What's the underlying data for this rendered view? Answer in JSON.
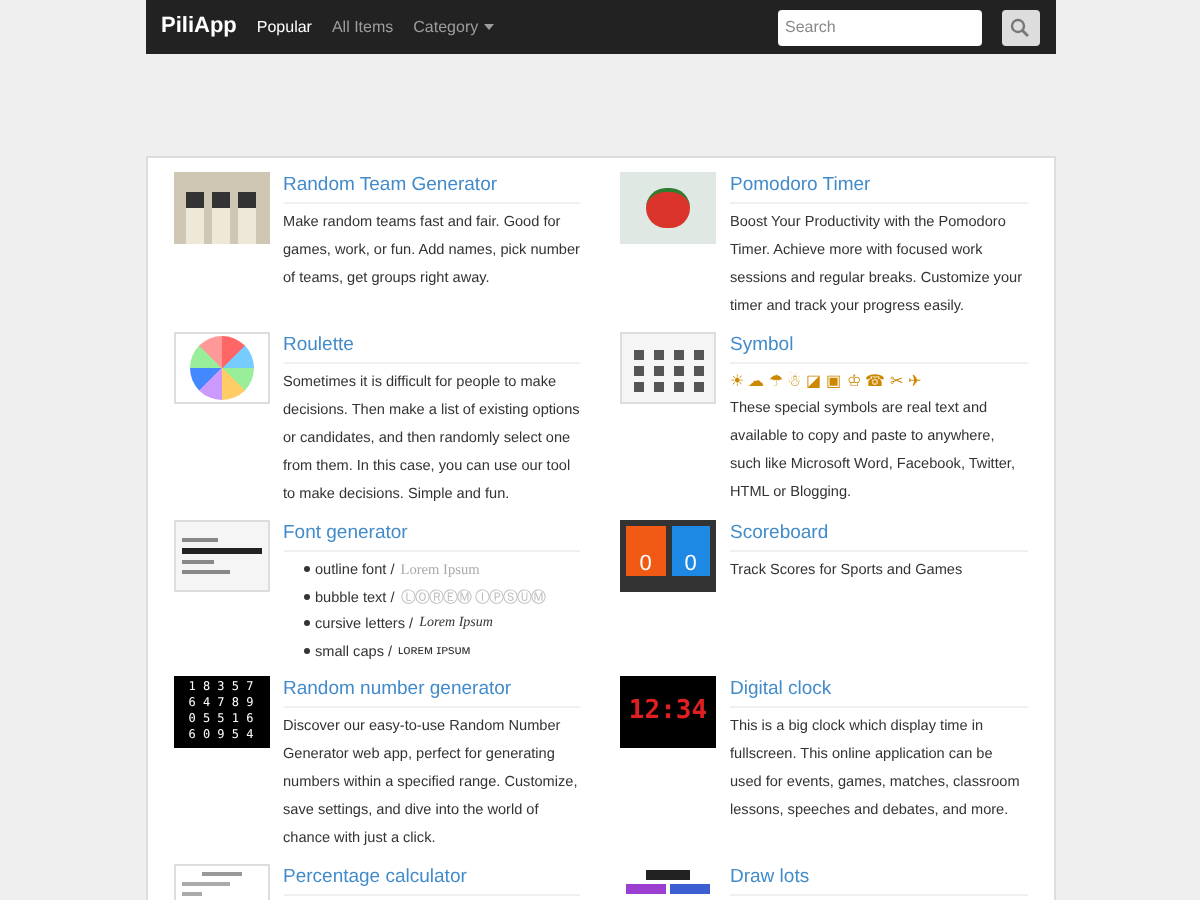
{
  "navbar": {
    "brand": "PiliApp",
    "links": [
      {
        "label": "Popular",
        "selected": true
      },
      {
        "label": "All Items",
        "selected": false
      },
      {
        "label": "Category",
        "selected": false,
        "dropdown": true
      }
    ],
    "search": {
      "placeholder": "Search"
    }
  },
  "items": [
    {
      "title": "Random Team Generator",
      "thumb": {
        "kind": "team"
      },
      "description": "Make random teams fast and fair. Good for games, work, or fun. Add names, pick number of teams, get groups right away."
    },
    {
      "title": "Pomodoro Timer",
      "thumb": {
        "kind": "tomato"
      },
      "description": "Boost Your Productivity with the Pomodoro Timer. Achieve more with focused work sessions and regular breaks. Customize your timer and track your progress easily."
    },
    {
      "title": "Roulette",
      "thumb": {
        "kind": "wheel"
      },
      "description": "Sometimes it is difficult for people to make decisions. Then make a list of existing options or candidates, and then randomly select one from them. In this case, you can use our tool to make decisions. Simple and fun."
    },
    {
      "title": "Symbol",
      "thumb": {
        "kind": "symbols"
      },
      "symbols": "☀ ☁ ☂ ☃ ◪ ▣ ♔ ☎ ✂ ✈",
      "description": "These special symbols are real text and available to copy and paste to anywhere, such like Microsoft Word, Facebook, Twitter, HTML or Blogging."
    },
    {
      "title": "Font generator",
      "thumb": {
        "kind": "fonts"
      },
      "list": [
        {
          "label": "outline font /",
          "sample": "Lorem Ipsum",
          "kind": "outline"
        },
        {
          "label": "bubble text /",
          "sample": "ⓁⓄⓇⒺⓂ ⒾⓅⓈⓊⓂ",
          "kind": "bubble"
        },
        {
          "label": "cursive letters /",
          "sample": "Lorem Ipsum",
          "kind": "cursive"
        },
        {
          "label": "small caps /",
          "sample": "ʟᴏʀᴇᴍ ɪᴘsᴜᴍ",
          "kind": "smallcaps"
        }
      ]
    },
    {
      "title": "Scoreboard",
      "thumb": {
        "kind": "scoreboard",
        "texts": [
          "0",
          "0"
        ]
      },
      "description": "Track Scores for Sports and Games"
    },
    {
      "title": "Random number generator",
      "thumb": {
        "kind": "numbers",
        "texts": [
          "1 8 3 5 7",
          "6 4 7 8 9",
          "0 5 5 1 6",
          "6 0 9 5 4"
        ]
      },
      "description": "Discover our easy-to-use Random Number Generator web app, perfect for generating numbers within a specified range. Customize, save settings, and dive into the world of chance with just a click."
    },
    {
      "title": "Digital clock",
      "thumb": {
        "kind": "clock",
        "texts": [
          "12:34"
        ]
      },
      "description": "This is a big clock which display time in fullscreen. This online application can be used for events, games, matches, classroom lessons, speeches and debates, and more."
    },
    {
      "title": "Percentage calculator",
      "thumb": {
        "kind": "calc"
      }
    },
    {
      "title": "Draw lots",
      "thumb": {
        "kind": "lots"
      }
    }
  ]
}
